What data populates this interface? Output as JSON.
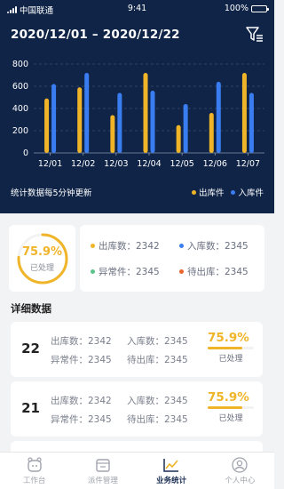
{
  "status_bar": {
    "carrier": "中国联通",
    "time": "9:41",
    "battery": "100%"
  },
  "header": {
    "date_range": "2020/12/01 – 2020/12/22"
  },
  "update_note": "统计数据每5分钟更新",
  "colors": {
    "outbound": "#f0b428",
    "inbound": "#3a7df0",
    "abnormal": "#5bc48a",
    "pending": "#e8652e",
    "hero_bg": "#0f2447"
  },
  "chart_data": {
    "type": "bar",
    "categories": [
      "12/01",
      "12/02",
      "12/03",
      "12/04",
      "12/05",
      "12/06",
      "12/07"
    ],
    "series": [
      {
        "name": "出库件",
        "values": [
          490,
          590,
          340,
          720,
          250,
          360,
          720
        ]
      },
      {
        "name": "入库件",
        "values": [
          620,
          720,
          540,
          560,
          440,
          640,
          540
        ]
      }
    ],
    "yticks": [
      "0",
      "200",
      "400",
      "600",
      "800"
    ],
    "ylim": [
      0,
      800
    ],
    "grid": true,
    "legend": "bottom-right"
  },
  "summary": {
    "percent": "75.9%",
    "percent_value": 0.759,
    "processed_label": "已处理",
    "outbound": "出库数：2342",
    "inbound": "入库数：2345",
    "abnormal": "异常件：2345",
    "pending": "待出库：2345"
  },
  "detail_title": "详细数据",
  "records": [
    {
      "day": "22",
      "outbound": "出库数：2342",
      "inbound": "入库数：2345",
      "abnormal": "异常件：2345",
      "pending": "待出库：2345",
      "percent": "75.9%",
      "percent_value": 0.759,
      "status": "已处理"
    },
    {
      "day": "21",
      "outbound": "出库数：2342",
      "inbound": "入库数：2345",
      "abnormal": "异常件：2345",
      "pending": "待出库：2345",
      "percent": "75.9%",
      "percent_value": 0.759,
      "status": "已处理"
    }
  ],
  "tabs": [
    {
      "label": "工作台",
      "icon": "workbench-icon",
      "active": false
    },
    {
      "label": "派件管理",
      "icon": "dispatch-icon",
      "active": false
    },
    {
      "label": "业务统计",
      "icon": "statistics-icon",
      "active": true
    },
    {
      "label": "个人中心",
      "icon": "profile-icon",
      "active": false
    }
  ]
}
